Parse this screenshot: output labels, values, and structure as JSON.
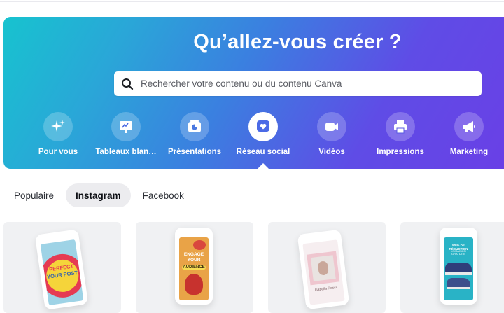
{
  "hero": {
    "title": "Qu’allez-vous créer ?",
    "search_placeholder": "Rechercher votre contenu ou du contenu Canva",
    "gradient_colors": [
      "#17c3cf",
      "#3b7fe0",
      "#6a3fe6"
    ]
  },
  "categories": [
    {
      "label": "Pour vous",
      "icon": "sparkles-icon",
      "active": false
    },
    {
      "label": "Tableaux blan…",
      "icon": "whiteboard-icon",
      "active": false
    },
    {
      "label": "Présentations",
      "icon": "presentation-icon",
      "active": false
    },
    {
      "label": "Réseau social",
      "icon": "heart-icon",
      "active": true
    },
    {
      "label": "Vidéos",
      "icon": "video-camera-icon",
      "active": false
    },
    {
      "label": "Impressions",
      "icon": "printer-icon",
      "active": false
    },
    {
      "label": "Marketing",
      "icon": "megaphone-icon",
      "active": false
    }
  ],
  "tabs": [
    {
      "label": "Populaire",
      "active": false
    },
    {
      "label": "Instagram",
      "active": true
    },
    {
      "label": "Facebook",
      "active": false
    }
  ],
  "templates": [
    {
      "name": "template-perfect-your-post",
      "lines": [
        "PERFECT",
        "YOUR POST"
      ]
    },
    {
      "name": "template-engage-your-audience",
      "lines": [
        "ENGAGE",
        "YOUR",
        "AUDIENCE"
      ]
    },
    {
      "name": "template-pink-frame",
      "lines": [
        "Isabella Rossi"
      ]
    },
    {
      "name": "template-sneakers-sale",
      "lines": [
        "50 % DE RÉDUCTION",
        "LIVRAISON GRATUITE"
      ]
    }
  ],
  "colors": {
    "accent": "#8b3dff",
    "active_tab_bg": "#ececef",
    "card_bg": "#f0f1f3"
  }
}
